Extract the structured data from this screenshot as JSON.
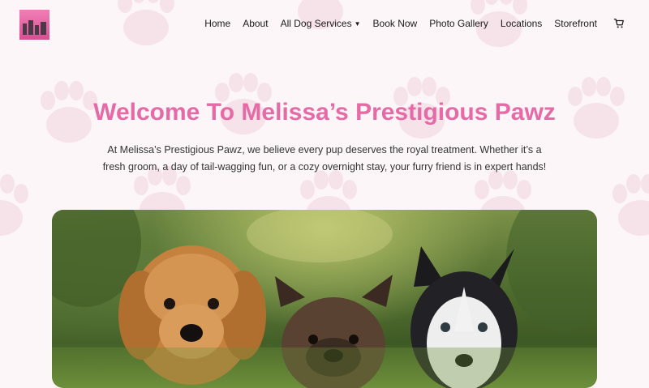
{
  "nav": {
    "items": [
      {
        "label": "Home"
      },
      {
        "label": "About"
      },
      {
        "label": "All Dog Services"
      },
      {
        "label": "Book Now"
      },
      {
        "label": "Photo Gallery"
      },
      {
        "label": "Locations"
      },
      {
        "label": "Storefront"
      }
    ],
    "cart_icon": "shopping-cart-icon",
    "dropdown_icon": "chevron-down-icon"
  },
  "hero": {
    "title": "Welcome To Melissa’s Prestigious Pawz",
    "intro": "At Melissa’s Prestigious Pawz, we believe every pup deserves the royal treatment. Whether it’s a fresh groom, a day of tail-wagging fun, or a cozy overnight stay, your furry friend is in expert hands!"
  },
  "colors": {
    "accent": "#e56aa6",
    "background": "#fdf6f8",
    "paw_print": "#f6e3ea"
  }
}
